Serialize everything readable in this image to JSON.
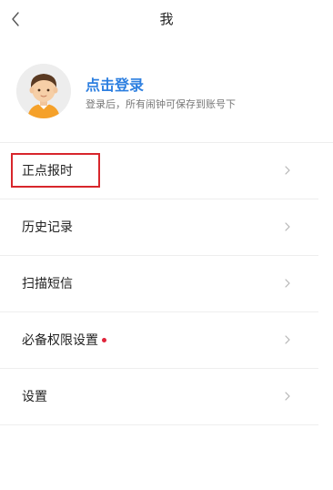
{
  "header": {
    "title": "我",
    "back_icon": "chevron-left-icon"
  },
  "profile": {
    "login_title": "点击登录",
    "login_subtitle": "登录后，所有闹钟可保存到账号下",
    "avatar_icon": "user-avatar-icon"
  },
  "menu": {
    "items": [
      {
        "label": "正点报时",
        "highlighted": true
      },
      {
        "label": "历史记录"
      },
      {
        "label": "扫描短信"
      },
      {
        "label": "必备权限设置",
        "badge_dot": true
      },
      {
        "label": "设置"
      }
    ],
    "chevron_icon": "chevron-right-icon"
  },
  "colors": {
    "accent": "#2d7fe0",
    "highlight_border": "#d8262c",
    "badge_dot": "#e0243a",
    "divider": "#eeeeee"
  }
}
